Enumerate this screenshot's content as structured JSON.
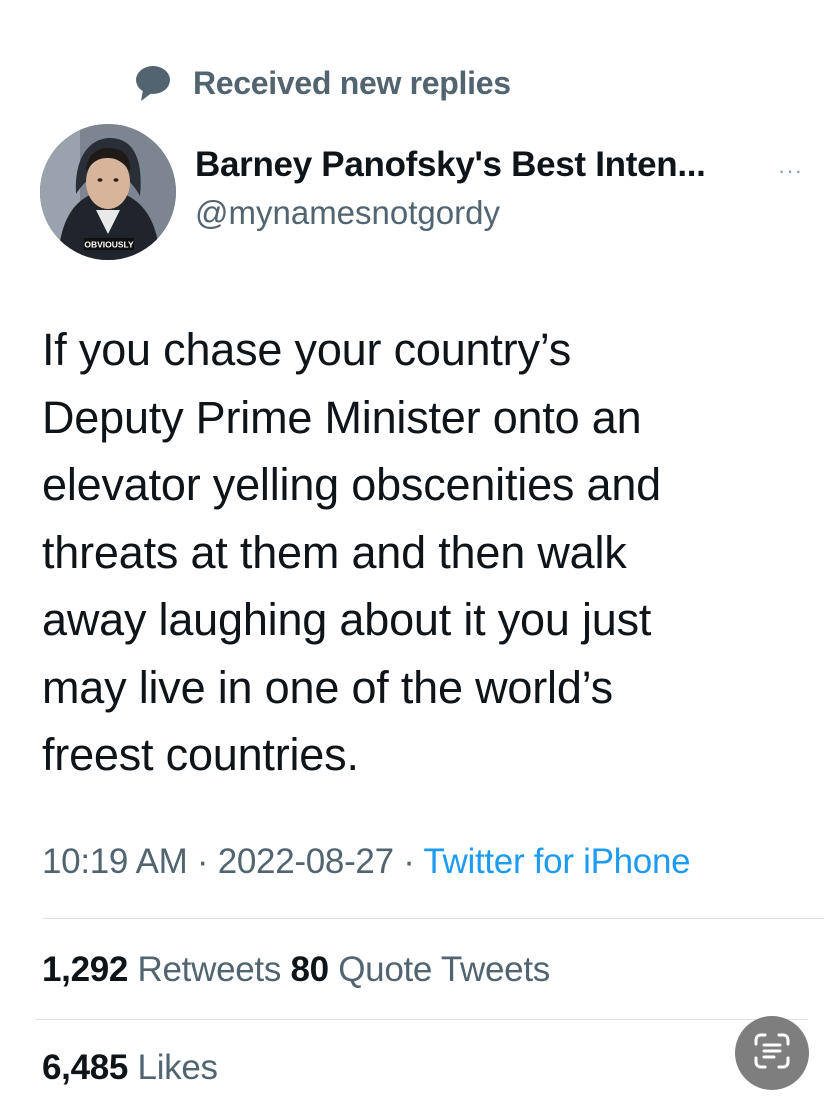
{
  "banner": {
    "icon": "speech-bubble-icon",
    "text": "Received new replies"
  },
  "author": {
    "avatar_caption": "OBVIOUSLY",
    "display_name": "Barney Panofsky's Best Inten...",
    "handle": "@mynamesnotgordy",
    "more_icon": "more-options-icon",
    "more_label": "···"
  },
  "tweet": {
    "lines": [
      "If you chase your country’s",
      "Deputy Prime Minister onto an",
      "elevator yelling obscenities and",
      "threats at them and then walk",
      "away laughing about it you just",
      "may live in one of the world’s",
      "freest countries."
    ]
  },
  "meta": {
    "time": "10:19 AM",
    "separator": "·",
    "date": "2022-08-27",
    "source": "Twitter for iPhone"
  },
  "stats": {
    "retweets_count": "1,292",
    "retweets_label": "Retweets",
    "quotes_count": "80",
    "quotes_label": "Quote Tweets",
    "likes_count": "6,485",
    "likes_label": "Likes"
  },
  "overlay": {
    "scan_icon": "live-text-scan-icon"
  },
  "colors": {
    "text_primary": "#0f1419",
    "text_secondary": "#536471",
    "link": "#1d9bf0",
    "divider": "#dfe3e6"
  }
}
